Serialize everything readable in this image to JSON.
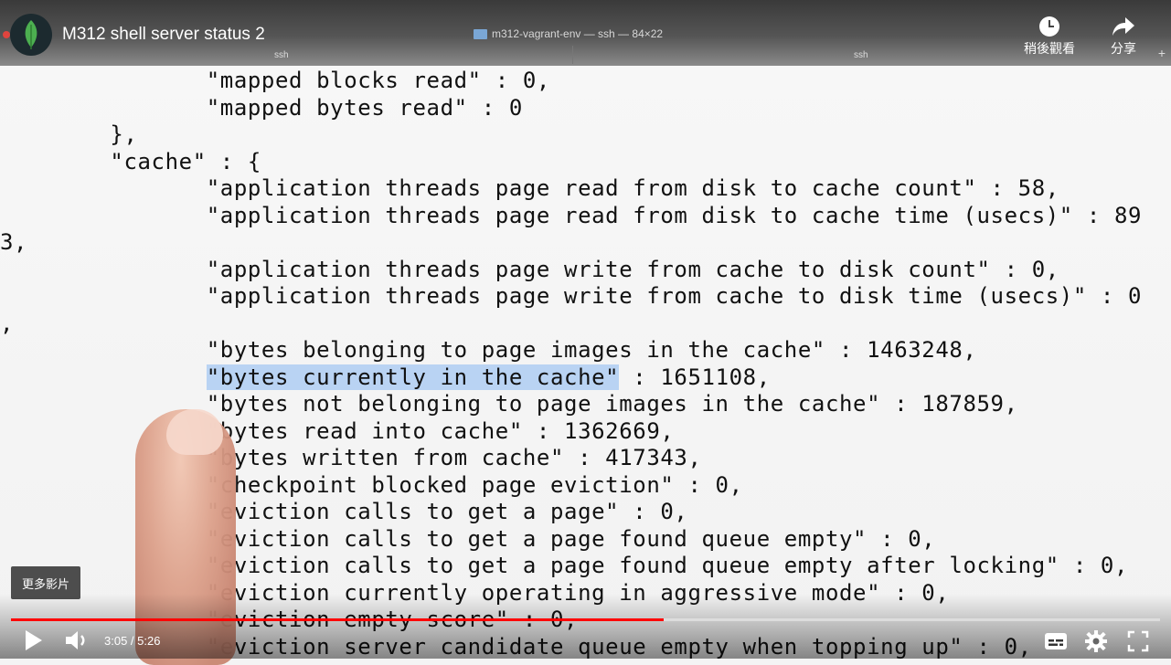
{
  "video": {
    "title": "M312 shell server status 2",
    "time_current": "3:05",
    "time_separator": " / ",
    "time_total": "5:26",
    "progress_fraction": 0.568,
    "more_videos_label": "更多影片"
  },
  "terminal_window": {
    "title": "m312-vagrant-env — ssh — 84×22",
    "tabs": [
      "ssh",
      "ssh"
    ]
  },
  "actions": {
    "watch_later_label": "稍後觀看",
    "share_label": "分享"
  },
  "terminal_lines": [
    "               \"mapped blocks read\" : 0,",
    "               \"mapped bytes read\" : 0",
    "        },",
    "        \"cache\" : {",
    "               \"application threads page read from disk to cache count\" : 58,",
    "               \"application threads page read from disk to cache time (usecs)\" : 89",
    "3,",
    "               \"application threads page write from cache to disk count\" : 0,",
    "               \"application threads page write from cache to disk time (usecs)\" : 0",
    ",",
    "               \"bytes belonging to page images in the cache\" : 1463248,",
    "               \"bytes currently in the cache\" : 1651108,",
    "               \"bytes not belonging to page images in the cache\" : 187859,",
    "               \"bytes read into cache\" : 1362669,",
    "               \"bytes written from cache\" : 417343,",
    "               \"checkpoint blocked page eviction\" : 0,",
    "               \"eviction calls to get a page\" : 0,",
    "               \"eviction calls to get a page found queue empty\" : 0,",
    "               \"eviction calls to get a page found queue empty after locking\" : 0,",
    "               \"eviction currently operating in aggressive mode\" : 0,",
    "               \"eviction empty score\" : 0,",
    "               \"eviction server candidate queue empty when topping up\" : 0,"
  ],
  "highlight": {
    "line": 11,
    "text": "\"bytes currently in the cache\""
  },
  "colors": {
    "progress": "#ff0000",
    "selection": "#b9d3f3"
  }
}
